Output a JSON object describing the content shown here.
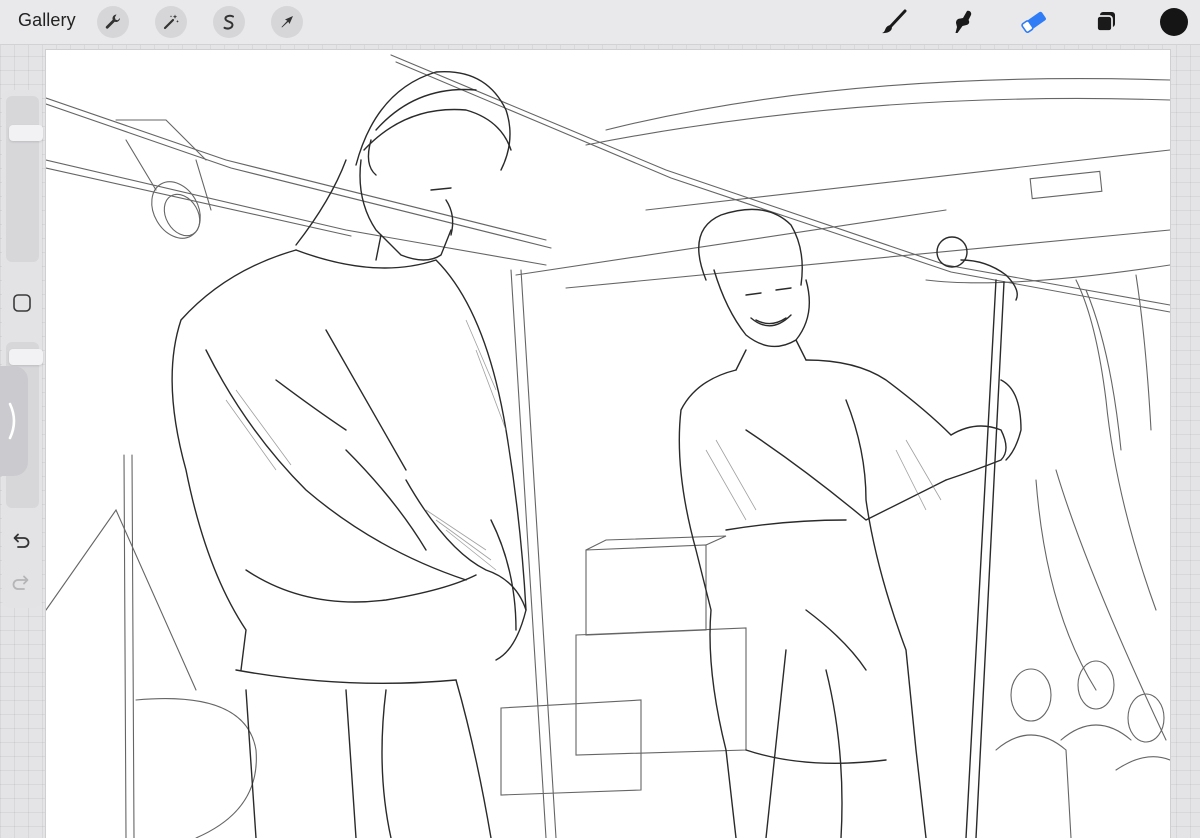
{
  "toolbar": {
    "gallery_label": "Gallery",
    "left_tools": [
      {
        "name": "actions",
        "icon": "wrench-icon"
      },
      {
        "name": "adjustments",
        "icon": "magic-wand-icon"
      },
      {
        "name": "selection",
        "icon": "selection-s-icon"
      },
      {
        "name": "transform",
        "icon": "arrow-cursor-icon"
      }
    ],
    "right_tools": [
      {
        "name": "brush",
        "icon": "brush-icon",
        "active": false
      },
      {
        "name": "smudge",
        "icon": "smudge-icon",
        "active": false
      },
      {
        "name": "eraser",
        "icon": "eraser-icon",
        "active": true
      },
      {
        "name": "layers",
        "icon": "layers-icon",
        "active": false
      }
    ],
    "current_color": "#151515",
    "accent_color": "#2f7cf6"
  },
  "sidebar": {
    "brush_size_level": 0.82,
    "opacity_level": 0.97,
    "modify_icon": "square-icon",
    "toggle_icon": "chevron-right-icon",
    "undo_icon": "undo-icon",
    "redo_icon": "redo-icon",
    "redo_enabled": false
  },
  "canvas": {
    "content": "pencil-sketch-artwork",
    "background": "#ffffff"
  }
}
